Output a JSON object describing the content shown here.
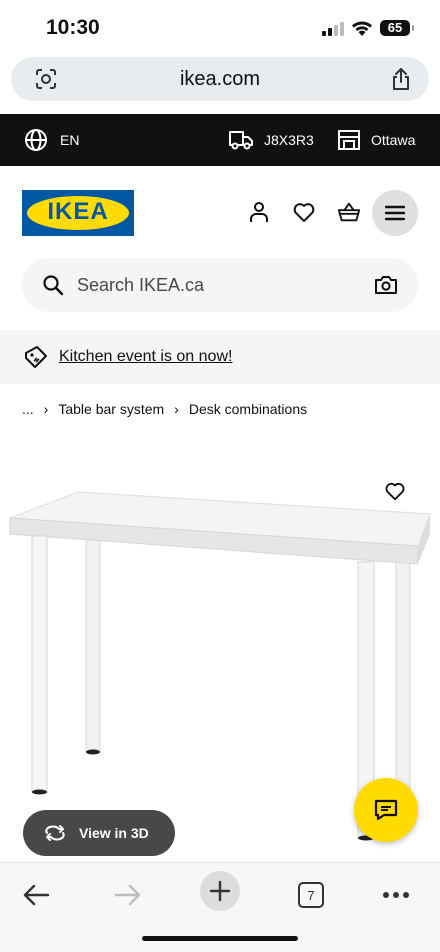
{
  "status_bar": {
    "time": "10:30",
    "battery": "65"
  },
  "browser": {
    "url": "ikea.com",
    "tab_count": "7"
  },
  "top_strip": {
    "language": "EN",
    "postal_code": "J8X3R3",
    "store": "Ottawa"
  },
  "header": {
    "logo_text": "IKEA"
  },
  "search": {
    "placeholder": "Search IKEA.ca"
  },
  "promo": {
    "text": "Kitchen event is on now!"
  },
  "breadcrumb": {
    "ellipsis": "...",
    "items": [
      "Table bar system",
      "Desk combinations"
    ]
  },
  "product": {
    "view_3d_label": "View in 3D"
  },
  "colors": {
    "brand_blue": "#0058a3",
    "brand_yellow": "#ffdb00",
    "dark": "#111111",
    "pill_gray": "#484848"
  },
  "icons": [
    "camera-lens-icon",
    "share-icon",
    "globe-icon",
    "truck-icon",
    "store-icon",
    "user-icon",
    "heart-icon",
    "basket-icon",
    "menu-icon",
    "search-icon",
    "camera-icon",
    "tag-icon",
    "rotate-3d-icon",
    "chat-icon",
    "back-arrow-icon",
    "forward-arrow-icon",
    "plus-icon",
    "more-icon"
  ]
}
